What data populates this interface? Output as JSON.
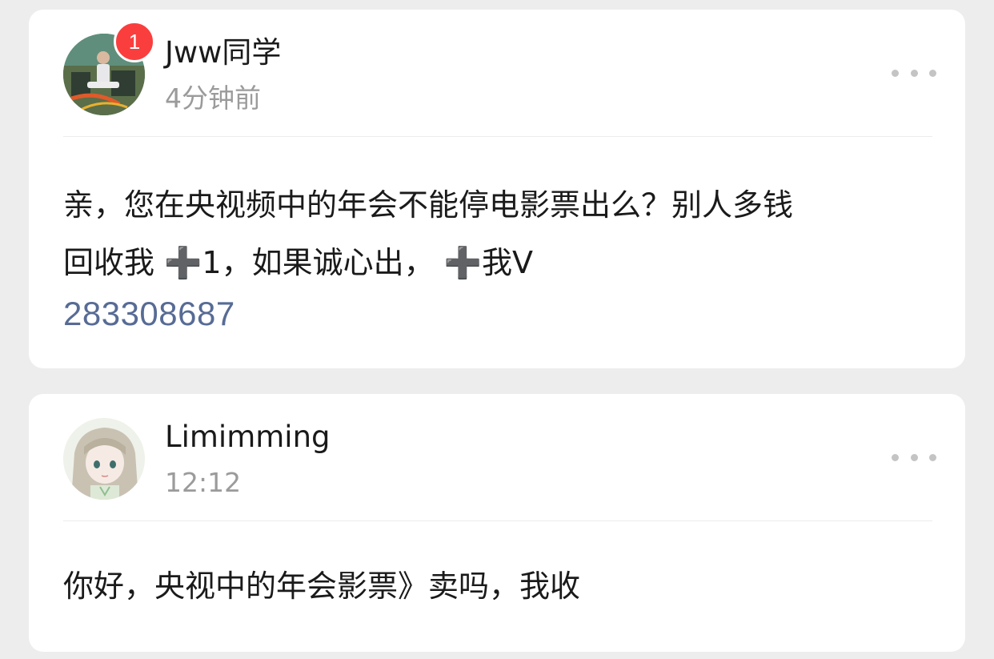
{
  "comments": [
    {
      "username": "Jww同学",
      "time": "4分钟前",
      "badge_count": "1",
      "avatar_icon": "avatar-photo-person-icon",
      "content": "亲，您在央视频中的年会不能停电影票出么？别人多钱\n回收我 ➕1，如果诚心出， ➕我V",
      "link_text": "283308687",
      "link_color": "#576b95"
    },
    {
      "username": "Limimming",
      "time": "12:12",
      "avatar_icon": "avatar-anime-girl-icon",
      "content": "你好，央视中的年会影票》卖吗，我收"
    }
  ],
  "colors": {
    "background": "#ededed",
    "card": "#ffffff",
    "badge": "#fa3e3e",
    "timestamp": "#9b9b9b",
    "more_dots": "#c4c4c4"
  },
  "more_icon": "more-dots-icon"
}
